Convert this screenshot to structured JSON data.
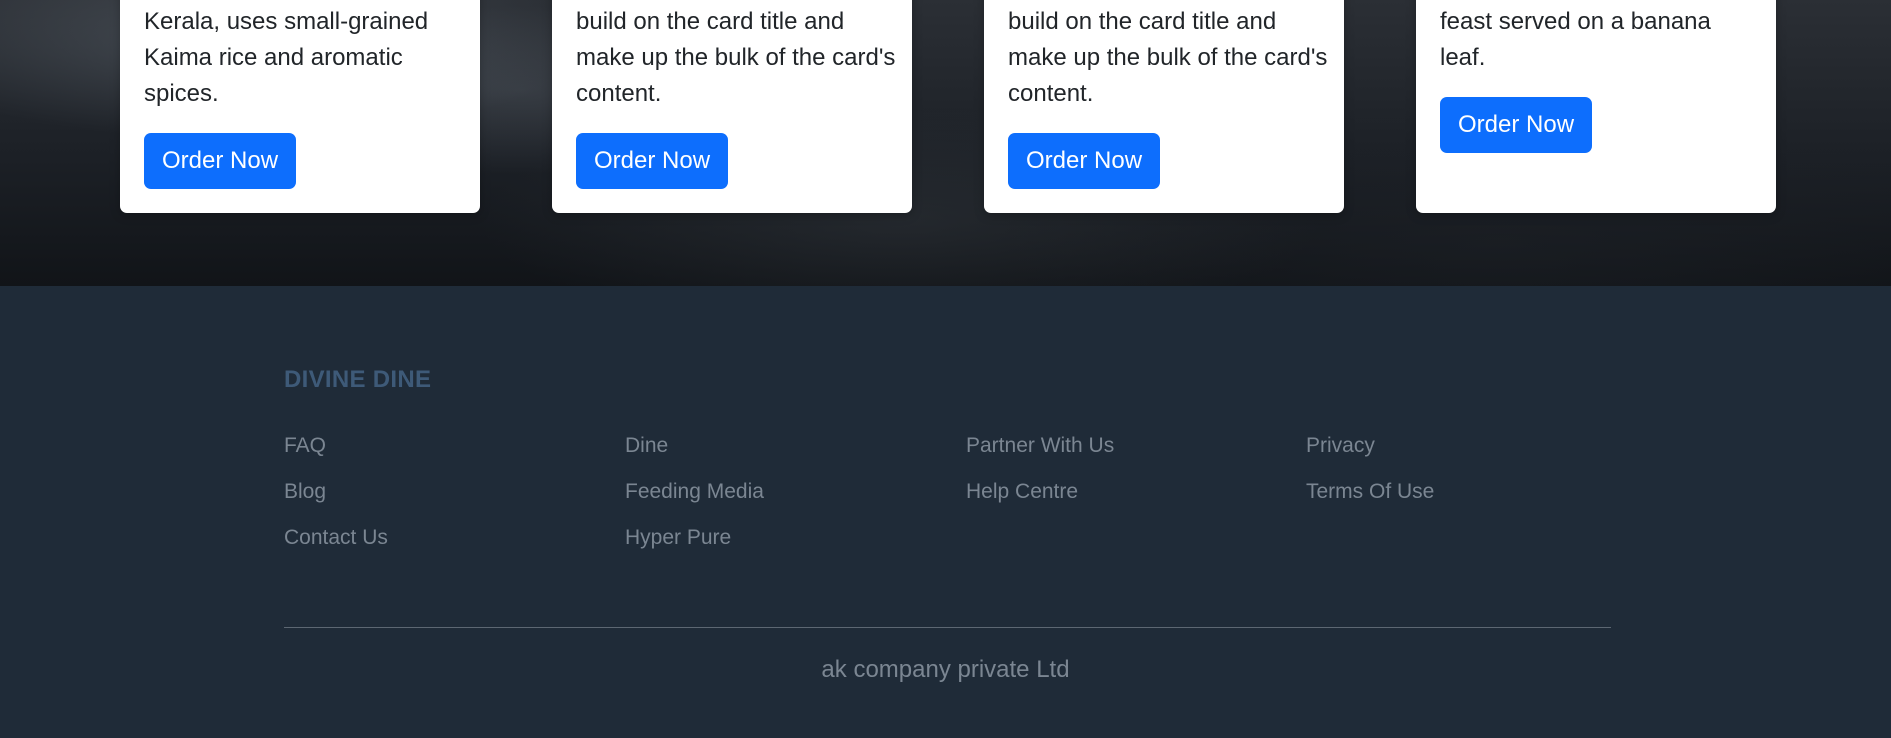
{
  "menu": {
    "cards": [
      {
        "text": "Kerala, uses small-grained Kaima rice and aromatic spices.",
        "button_label": "Order Now"
      },
      {
        "text": "build on the card title and make up the bulk of the card's content.",
        "button_label": "Order Now"
      },
      {
        "text": "build on the card title and make up the bulk of the card's content.",
        "button_label": "Order Now"
      },
      {
        "text": "feast served on a banana leaf.",
        "button_label": "Order Now"
      }
    ]
  },
  "footer": {
    "brand": "DIVINE DINE",
    "columns": [
      {
        "links": [
          "FAQ",
          "Blog",
          "Contact Us"
        ]
      },
      {
        "links": [
          "Dine",
          "Feeding Media",
          "Hyper Pure"
        ]
      },
      {
        "links": [
          "Partner With Us",
          "Help Centre"
        ]
      },
      {
        "links": [
          "Privacy",
          "Terms Of Use"
        ]
      }
    ],
    "copyright": "ak company private Ltd"
  },
  "colors": {
    "button": "#0d6efd",
    "footer_bg": "#1f2b38",
    "brand": "#3e5a78",
    "link": "#7b8692"
  }
}
